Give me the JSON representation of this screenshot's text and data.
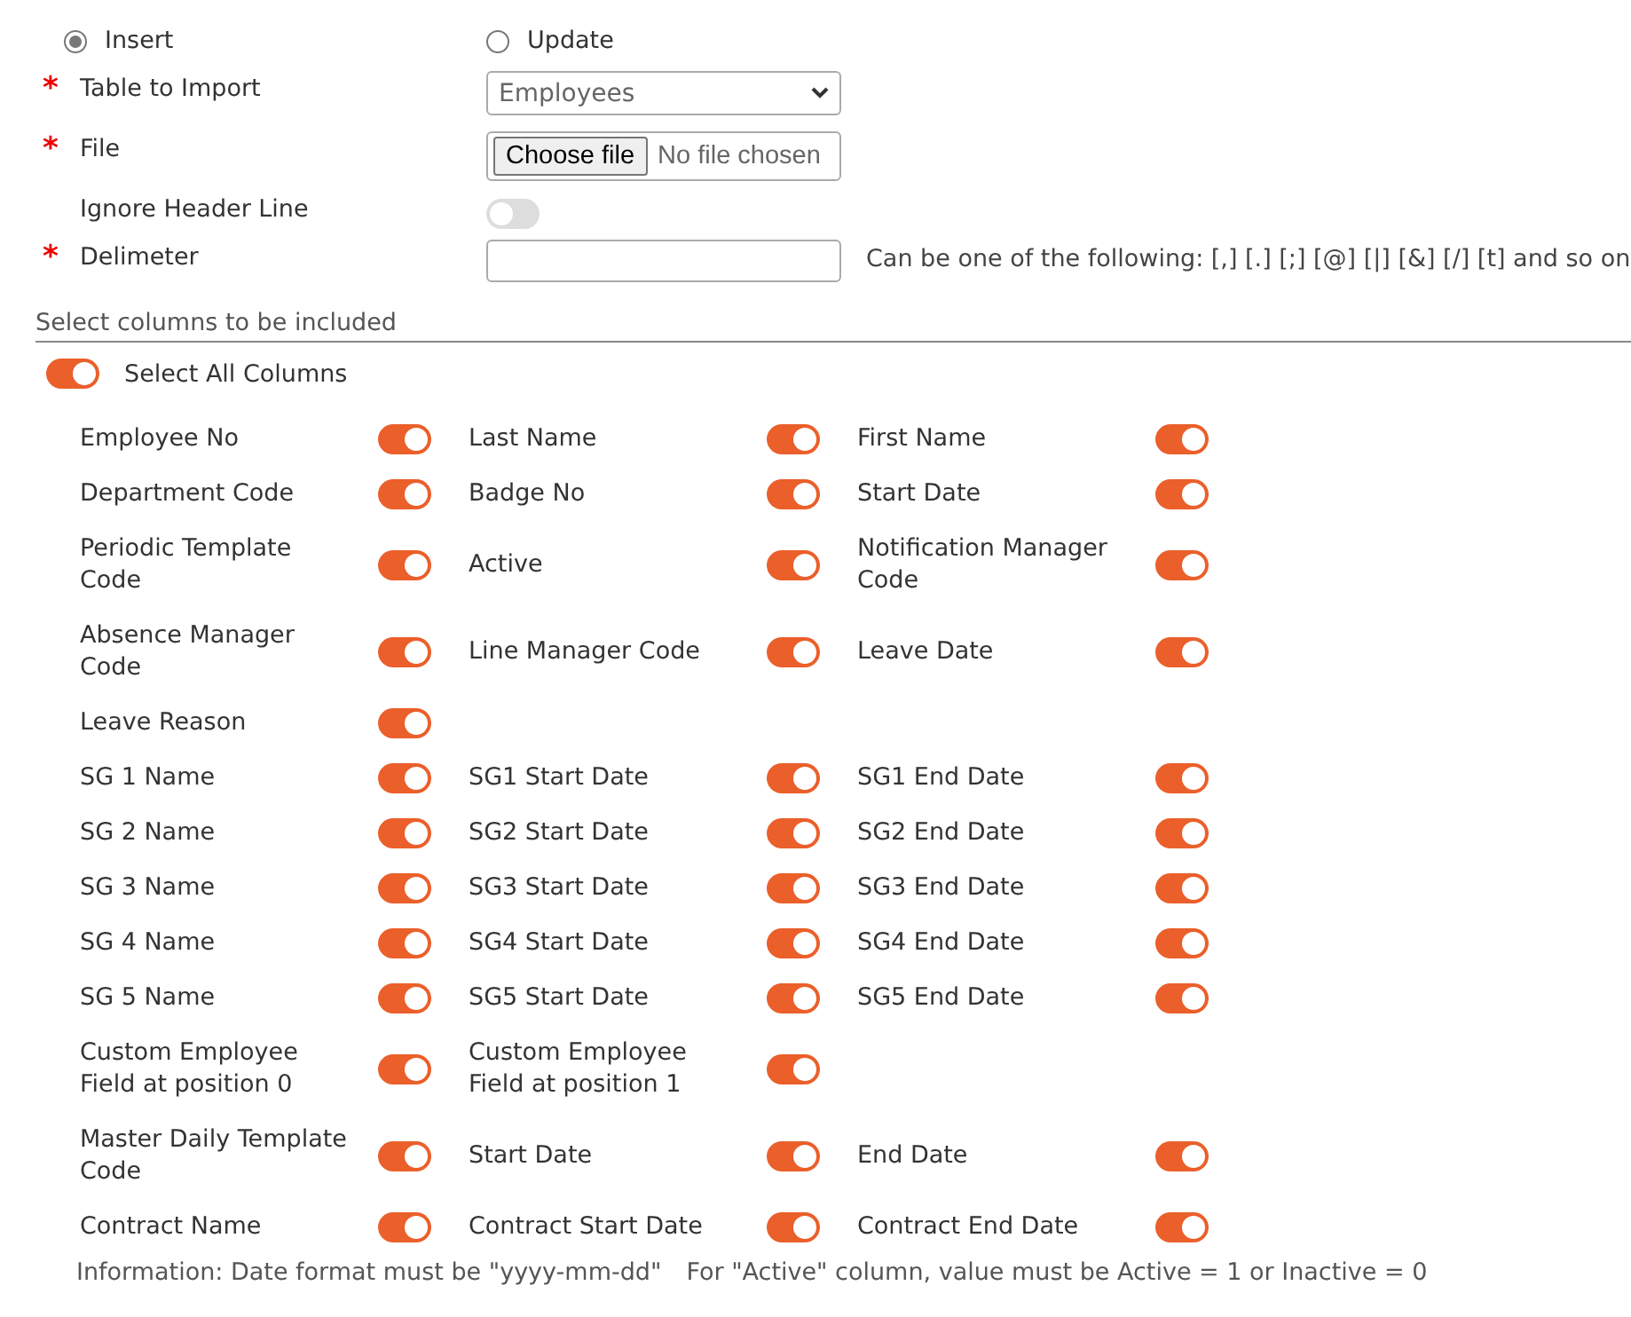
{
  "mode": [
    {
      "label": "Insert",
      "selected": true
    },
    {
      "label": "Update",
      "selected": false
    }
  ],
  "fields": [
    {
      "kind": "select",
      "label": "Table to Import",
      "marker": "*",
      "value": "Employees"
    },
    {
      "kind": "file",
      "label": "File",
      "marker": "*",
      "button": "Choose file",
      "value": "No file chosen"
    },
    {
      "kind": "toggle",
      "label": "Ignore Header Line",
      "on": false
    },
    {
      "kind": "text",
      "label": "Delimeter",
      "marker": "*",
      "hint": "Can be one of the following: [,] [.] [;] [@] [|] [&] [/] [t] and so on"
    }
  ],
  "section_title": "Select columns to be included",
  "select_all": {
    "label": "Select All Columns",
    "on": true
  },
  "column_rows": [
    [
      {
        "label": "Employee No",
        "on": true
      },
      {
        "label": "Last Name",
        "on": true
      },
      {
        "label": "First Name",
        "on": true
      }
    ],
    [
      {
        "label": "Department Code",
        "on": true
      },
      {
        "label": "Badge No",
        "on": true
      },
      {
        "label": "Start Date",
        "on": true
      }
    ],
    [
      {
        "label": "Periodic Template Code",
        "on": true
      },
      {
        "label": "Active",
        "on": true
      },
      {
        "label": "Notification Manager Code",
        "on": true
      }
    ],
    [
      {
        "label": "Absence Manager Code",
        "on": true
      },
      {
        "label": "Line Manager Code",
        "on": true
      },
      {
        "label": "Leave Date",
        "on": true
      }
    ],
    [
      {
        "label": "Leave Reason",
        "on": true
      }
    ],
    [
      {
        "label": "SG 1 Name",
        "on": true
      },
      {
        "label": "SG1 Start Date",
        "on": true
      },
      {
        "label": "SG1 End Date",
        "on": true
      }
    ],
    [
      {
        "label": "SG 2 Name",
        "on": true
      },
      {
        "label": "SG2 Start Date",
        "on": true
      },
      {
        "label": "SG2 End Date",
        "on": true
      }
    ],
    [
      {
        "label": "SG 3 Name",
        "on": true
      },
      {
        "label": "SG3 Start Date",
        "on": true
      },
      {
        "label": "SG3 End Date",
        "on": true
      }
    ],
    [
      {
        "label": "SG 4 Name",
        "on": true
      },
      {
        "label": "SG4 Start Date",
        "on": true
      },
      {
        "label": "SG4 End Date",
        "on": true
      }
    ],
    [
      {
        "label": "SG 5 Name",
        "on": true
      },
      {
        "label": "SG5 Start Date",
        "on": true
      },
      {
        "label": "SG5 End Date",
        "on": true
      }
    ],
    [
      {
        "label": "Custom Employee Field at position 0",
        "on": true
      },
      {
        "label": "Custom Employee Field at position 1",
        "on": true
      }
    ],
    [
      {
        "label": "Master Daily Template Code",
        "on": true
      },
      {
        "label": "Start Date",
        "on": true
      },
      {
        "label": "End Date",
        "on": true
      }
    ],
    [
      {
        "label": "Contract Name",
        "on": true
      },
      {
        "label": "Contract Start Date",
        "on": true
      },
      {
        "label": "Contract End Date",
        "on": true
      }
    ]
  ],
  "info": [
    "Information: Date format must be \"yyyy-mm-dd\"",
    "For \"Active\" column, value must be Active = 1 or Inactive = 0"
  ]
}
